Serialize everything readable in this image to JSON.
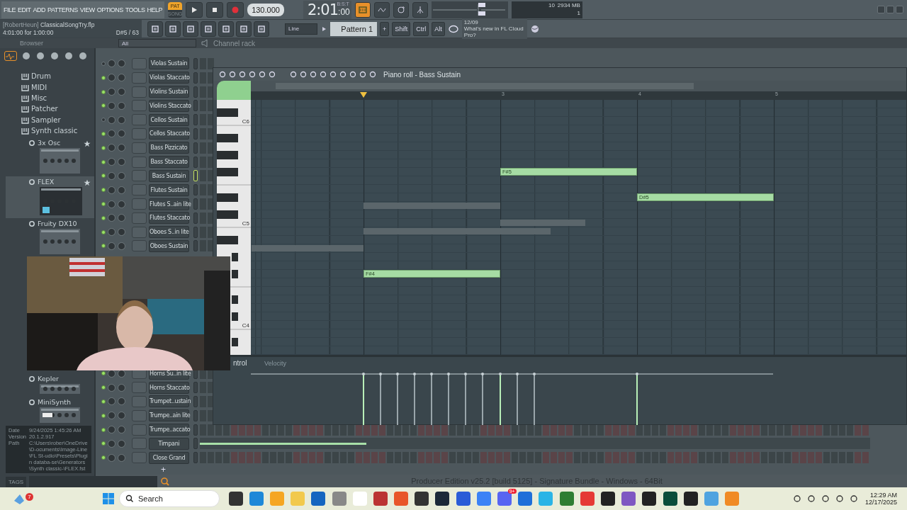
{
  "menu": [
    "FILE",
    "EDIT",
    "ADD",
    "PATTERNS",
    "VIEW",
    "OPTIONS",
    "TOOLS",
    "HELP"
  ],
  "transport": {
    "modes": [
      {
        "label": "PAT",
        "selected": true
      },
      {
        "label": "SONG",
        "selected": false
      }
    ],
    "tempo": "130.000",
    "time": "2:01",
    "time_ticks": ":00",
    "time_unit": "B:S:T"
  },
  "monitor": {
    "cpu": "10",
    "memory": "2934 MB",
    "polyphony": "1"
  },
  "song": {
    "user": "[RobertHeun]",
    "file": "ClassicalSongTry.flp",
    "length": "4:01:00 for 1:00:00",
    "hint": "D#5 / 63"
  },
  "snap": "Line",
  "pattern": "Pattern 1",
  "pattern_add": "+",
  "modifier_keys": [
    "Shift",
    "Ctrl",
    "Alt"
  ],
  "news": {
    "date": "12/09",
    "text": "What's new in FL Cloud Pro?"
  },
  "browser": {
    "title": "Browser",
    "filter": "All",
    "tabs": [
      {
        "selected": true
      },
      {
        "selected": false
      },
      {
        "selected": false
      },
      {
        "selected": false
      },
      {
        "selected": false
      },
      {
        "selected": false
      }
    ],
    "items": [
      {
        "label": "Drum"
      },
      {
        "label": "MIDI"
      },
      {
        "label": "Misc"
      },
      {
        "label": "Patcher"
      },
      {
        "label": "Sampler"
      },
      {
        "label": "Synth classic",
        "children": [
          {
            "label": "3x Osc",
            "selected": false
          },
          {
            "label": "FLEX",
            "selected": true
          },
          {
            "label": "Fruity DX10",
            "selected": false
          },
          {
            "label": "Kepler",
            "selected": false
          },
          {
            "label": "MiniSynth",
            "selected": false
          }
        ]
      }
    ],
    "info": [
      {
        "key": "Date",
        "value": "9/24/2025 1:45:26 AM"
      },
      {
        "key": "Version",
        "value": "20.1.2.917"
      },
      {
        "key": "Path",
        "value": "C:\\Users\\rober\\OneDrive\\D-ocuments\\Image-Line\\FL St-udio\\Presets\\Plugin databa-se\\Generators\\Synth classic-\\FLEX.fst"
      }
    ],
    "tags": "TAGS"
  },
  "channel_rack": {
    "title": "Channel rack",
    "add": "+",
    "channels": [
      {
        "name": "Violas Sustain",
        "on": false,
        "selected": false,
        "kind": "steps"
      },
      {
        "name": "Violas Staccato",
        "on": true,
        "selected": false,
        "kind": "steps"
      },
      {
        "name": "Violins Sustain",
        "on": true,
        "selected": false,
        "kind": "steps"
      },
      {
        "name": "Violins Staccato",
        "on": true,
        "selected": false,
        "kind": "steps"
      },
      {
        "name": "Cellos Sustain",
        "on": false,
        "selected": false,
        "kind": "steps"
      },
      {
        "name": "Cellos Staccato",
        "on": true,
        "selected": false,
        "kind": "steps"
      },
      {
        "name": "Bass Pizzicato",
        "on": true,
        "selected": false,
        "kind": "steps"
      },
      {
        "name": "Bass Staccato",
        "on": true,
        "selected": false,
        "kind": "steps"
      },
      {
        "name": "Bass Sustain",
        "on": true,
        "selected": true,
        "kind": "steps"
      },
      {
        "name": "Flutes Sustain",
        "on": true,
        "selected": false,
        "kind": "steps"
      },
      {
        "name": "Flutes S..ain lite",
        "on": true,
        "selected": false,
        "kind": "steps"
      },
      {
        "name": "Flutes Staccato",
        "on": true,
        "selected": false,
        "kind": "steps"
      },
      {
        "name": "Oboes S..in lite",
        "on": true,
        "selected": false,
        "kind": "steps"
      },
      {
        "name": "Oboes Sustain",
        "on": true,
        "selected": false,
        "kind": "steps"
      },
      {
        "name": "Horns Su..in lite",
        "on": true,
        "selected": false,
        "kind": "steps"
      },
      {
        "name": "Horns Staccato",
        "on": true,
        "selected": false,
        "kind": "steps"
      },
      {
        "name": "Trumpet..ustain",
        "on": true,
        "selected": false,
        "kind": "steps"
      },
      {
        "name": "Trumpe..ain lite",
        "on": true,
        "selected": false,
        "kind": "steps"
      },
      {
        "name": "Trumpe..accato",
        "on": true,
        "selected": false,
        "kind": "steps"
      },
      {
        "name": "Timpani",
        "on": true,
        "selected": false,
        "kind": "graph"
      },
      {
        "name": "Close Grand",
        "on": true,
        "selected": false,
        "kind": "steps"
      }
    ]
  },
  "piano_roll": {
    "title": "Piano roll - Bass Sustain",
    "bars": [
      "3",
      "4",
      "5"
    ],
    "keys": [
      "C6",
      "C5",
      "C4"
    ],
    "notes": [
      {
        "label": "F#5"
      },
      {
        "label": "D#5"
      },
      {
        "label": "F#4"
      }
    ],
    "event_editor": {
      "title": "ntrol",
      "parameter": "Velocity"
    }
  },
  "status_bar": "Producer Edition v25.2 [build 5125] - Signature Bundle - Windows - 64Bit",
  "taskbar": {
    "notifications": "7",
    "search": "Search",
    "app_badge": "9+",
    "time": "12:29 AM",
    "date": "12/17/2025"
  }
}
